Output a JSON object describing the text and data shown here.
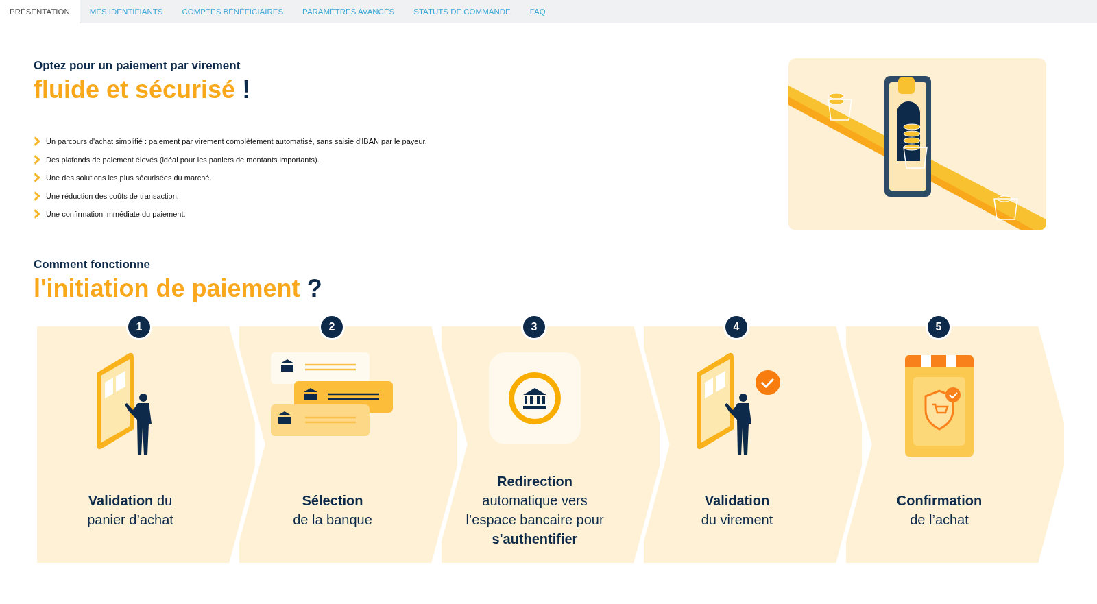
{
  "tabs": [
    {
      "label": "PRÉSENTATION",
      "selected": true
    },
    {
      "label": "MES IDENTIFIANTS",
      "selected": false
    },
    {
      "label": "COMPTES BÉNÉFICIAIRES",
      "selected": false
    },
    {
      "label": "PARAMÈTRES AVANCÉS",
      "selected": false
    },
    {
      "label": "STATUTS DE COMMANDE",
      "selected": false
    },
    {
      "label": "FAQ",
      "selected": false
    }
  ],
  "intro": {
    "lead": "Optez pour un paiement par virement",
    "highlight": "fluide et sécurisé",
    "end": "!",
    "benefits": [
      "Un parcours d'achat simplifié : paiement par virement complètement automatisé, sans saisie d'IBAN par le payeur.",
      "Des plafonds de paiement élevés (idéal pour les paniers de montants importants).",
      "Une des solutions les plus sécurisées du marché.",
      "Une réduction des coûts de transaction.",
      "Une confirmation immédiate du paiement."
    ]
  },
  "how": {
    "lead": "Comment fonctionne",
    "highlight": "l'initiation de paiement",
    "end": "?",
    "steps": [
      {
        "number": "1",
        "kind": "phone",
        "lines": [
          "**Validation** du",
          "panier d’achat"
        ]
      },
      {
        "number": "2",
        "kind": "banks",
        "lines": [
          "**Sélection**",
          "de la banque"
        ]
      },
      {
        "number": "3",
        "kind": "bank",
        "lines": [
          "**Redirection**",
          "automatique vers",
          "l’espace bancaire pour",
          "**s'authentifier**"
        ]
      },
      {
        "number": "4",
        "kind": "phonecheck",
        "lines": [
          "**Validation**",
          "du virement"
        ]
      },
      {
        "number": "5",
        "kind": "shop",
        "lines": [
          "**Confirmation**",
          "de l’achat"
        ]
      }
    ]
  }
}
